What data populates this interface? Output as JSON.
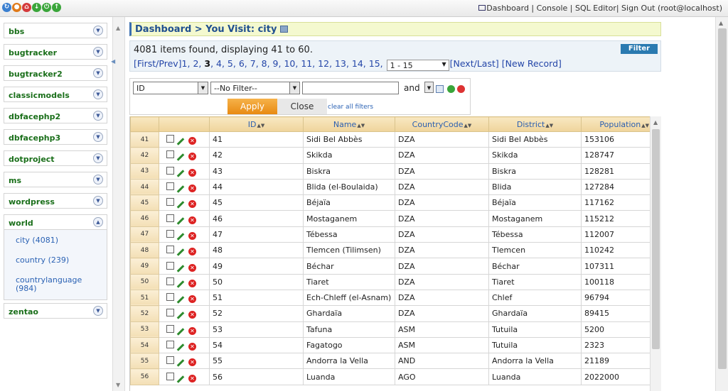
{
  "topbar": {
    "links": [
      "Dashboard",
      "Console",
      "SQL Editor",
      "Sign Out (root@localhost)"
    ],
    "sep": " | ",
    "sep_tight": "| "
  },
  "sidebar": {
    "databases": [
      "bbs",
      "bugtracker",
      "bugtracker2",
      "classicmodels",
      "dbfacephp2",
      "dbfacephp3",
      "dotproject",
      "ms",
      "wordpress",
      "world",
      "zentao"
    ],
    "world_tables": [
      "city (4081)",
      "country (239)",
      "countrylanguage (984)"
    ]
  },
  "breadcrumb": {
    "text": "Dashboard > You Visit: city"
  },
  "info": {
    "summary": "4081 items found, displaying 41 to 60.",
    "filter_button": "Filter"
  },
  "pager": {
    "first_prev": "[First/Prev]",
    "pages": [
      "1",
      "2",
      "3",
      "4",
      "5",
      "6",
      "7",
      "8",
      "9",
      "10",
      "11",
      "12",
      "13",
      "14",
      "15"
    ],
    "current_page": "3",
    "range_select": "1 - 15",
    "next_last": "[Next/Last]",
    "new_record": "[New Record]"
  },
  "filter": {
    "field": "ID",
    "operator": "--No Filter--",
    "value": "",
    "join": "and",
    "apply": "Apply",
    "close": "Close",
    "clear": "clear all filters"
  },
  "grid": {
    "columns": [
      "ID",
      "Name",
      "CountryCode",
      "District",
      "Population"
    ],
    "rows": [
      {
        "n": "41",
        "id": "41",
        "name": "Sidi Bel Abbès",
        "code": "DZA",
        "district": "Sidi Bel Abbès",
        "pop": "153106"
      },
      {
        "n": "42",
        "id": "42",
        "name": "Skikda",
        "code": "DZA",
        "district": "Skikda",
        "pop": "128747"
      },
      {
        "n": "43",
        "id": "43",
        "name": "Biskra",
        "code": "DZA",
        "district": "Biskra",
        "pop": "128281"
      },
      {
        "n": "44",
        "id": "44",
        "name": "Blida (el-Boulaida)",
        "code": "DZA",
        "district": "Blida",
        "pop": "127284"
      },
      {
        "n": "45",
        "id": "45",
        "name": "Béjaïa",
        "code": "DZA",
        "district": "Béjaïa",
        "pop": "117162"
      },
      {
        "n": "46",
        "id": "46",
        "name": "Mostaganem",
        "code": "DZA",
        "district": "Mostaganem",
        "pop": "115212"
      },
      {
        "n": "47",
        "id": "47",
        "name": "Tébessa",
        "code": "DZA",
        "district": "Tébessa",
        "pop": "112007"
      },
      {
        "n": "48",
        "id": "48",
        "name": "Tlemcen (Tilimsen)",
        "code": "DZA",
        "district": "Tlemcen",
        "pop": "110242"
      },
      {
        "n": "49",
        "id": "49",
        "name": "Béchar",
        "code": "DZA",
        "district": "Béchar",
        "pop": "107311"
      },
      {
        "n": "50",
        "id": "50",
        "name": "Tiaret",
        "code": "DZA",
        "district": "Tiaret",
        "pop": "100118"
      },
      {
        "n": "51",
        "id": "51",
        "name": "Ech-Chleff (el-Asnam)",
        "code": "DZA",
        "district": "Chlef",
        "pop": "96794"
      },
      {
        "n": "52",
        "id": "52",
        "name": "Ghardaïa",
        "code": "DZA",
        "district": "Ghardaïa",
        "pop": "89415"
      },
      {
        "n": "53",
        "id": "53",
        "name": "Tafuna",
        "code": "ASM",
        "district": "Tutuila",
        "pop": "5200"
      },
      {
        "n": "54",
        "id": "54",
        "name": "Fagatogo",
        "code": "ASM",
        "district": "Tutuila",
        "pop": "2323"
      },
      {
        "n": "55",
        "id": "55",
        "name": "Andorra la Vella",
        "code": "AND",
        "district": "Andorra la Vella",
        "pop": "21189"
      },
      {
        "n": "56",
        "id": "56",
        "name": "Luanda",
        "code": "AGO",
        "district": "Luanda",
        "pop": "2022000"
      }
    ]
  },
  "colors": {
    "accent_blue": "#2b62b4",
    "db_green": "#1a6f1a",
    "breadcrumb_bg": "#f4f9cf",
    "apply_orange": "#e88a12",
    "header_tan": "#efd49b"
  }
}
